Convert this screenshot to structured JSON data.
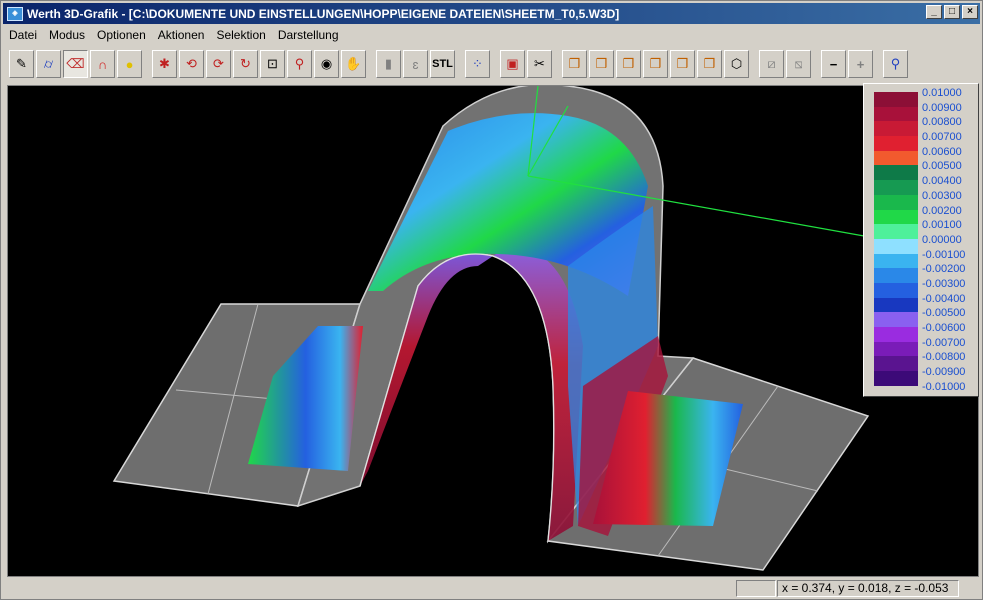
{
  "window": {
    "title": "Werth 3D-Grafik - [C:\\DOKUMENTE UND EINSTELLUNGEN\\HOPP\\EIGENE DATEIEN\\SHEETM_T0,5.W3D]",
    "icon": "app-icon"
  },
  "menu": [
    "Datei",
    "Modus",
    "Optionen",
    "Aktionen",
    "Selektion",
    "Darstellung"
  ],
  "toolbar": {
    "stl_label": "STL"
  },
  "legend": {
    "colors": [
      "#8c0f36",
      "#a8113a",
      "#c81a35",
      "#e02030",
      "#f25a2e",
      "#0e7a48",
      "#169a52",
      "#1ab84c",
      "#20d848",
      "#4ef09a",
      "#8ee0ff",
      "#3ab4f0",
      "#2a88e8",
      "#2460e0",
      "#1838c0",
      "#8a60f0",
      "#9a2ce0",
      "#7a1cb8",
      "#5a1490",
      "#3c0a78"
    ],
    "labels": [
      "0.01000",
      "0.00900",
      "0.00800",
      "0.00700",
      "0.00600",
      "0.00500",
      "0.00400",
      "0.00300",
      "0.00200",
      "0.00100",
      "0.00000",
      "-0.00100",
      "-0.00200",
      "-0.00300",
      "-0.00400",
      "-0.00500",
      "-0.00600",
      "-0.00700",
      "-0.00800",
      "-0.00900",
      "-0.01000"
    ]
  },
  "status": {
    "coords": "x = 0.374, y = 0.018, z = -0.053"
  }
}
